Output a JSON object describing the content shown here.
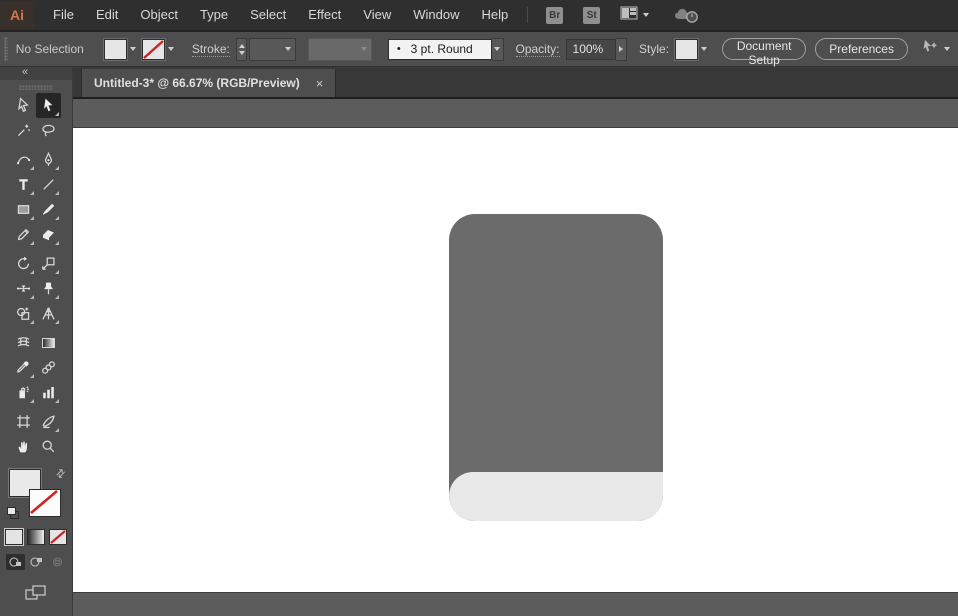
{
  "colors": {
    "menu_bar_bg": "#2f2f2f",
    "control_bar_bg": "#4e4e4e",
    "panel_bg": "#4e4e4e",
    "tab_bar_bg": "#383838",
    "tab_active_bg": "#4e4e4e",
    "pasteboard": "#5c5c5c",
    "artboard": "#ffffff",
    "shape_dark": "#6b6b6b",
    "shape_light": "#e9e9e9",
    "logo_orange": "#d0784a",
    "stroke_none_red": "#cc2222",
    "selected_tool_bg": "#262626"
  },
  "icons": {
    "collapse_panel": "«",
    "swap_fill_stroke": "⇄",
    "tab_close": "×"
  },
  "menu_bar": {
    "logo": "Ai",
    "items": [
      "File",
      "Edit",
      "Object",
      "Type",
      "Select",
      "Effect",
      "View",
      "Window",
      "Help"
    ],
    "bridge_badge": "Br",
    "stock_badge": "St"
  },
  "control_bar": {
    "selection_status": "No Selection",
    "stroke_label": "Stroke:",
    "brush_bullet": "•",
    "brush_name": "3 pt. Round",
    "opacity_label": "Opacity:",
    "opacity_value": "100%",
    "style_label": "Style:",
    "document_setup_button": "Document Setup",
    "preferences_button": "Preferences"
  },
  "document_tab": {
    "title": "Untitled-3* @ 66.67% (RGB/Preview)"
  },
  "toolbar": {
    "active_tool": "direct-selection-tool",
    "tools": [
      "selection",
      "direct-selection",
      "magic-wand",
      "lasso",
      "curvature",
      "pen",
      "type",
      "line-segment",
      "rectangle",
      "paintbrush",
      "pencil",
      "eraser",
      "rotate",
      "scale",
      "width",
      "puppet-warp",
      "shape-builder",
      "perspective-grid",
      "mesh",
      "gradient",
      "eyedropper",
      "blend",
      "symbol-sprayer",
      "column-graph",
      "artboard",
      "slice",
      "hand",
      "zoom"
    ]
  }
}
